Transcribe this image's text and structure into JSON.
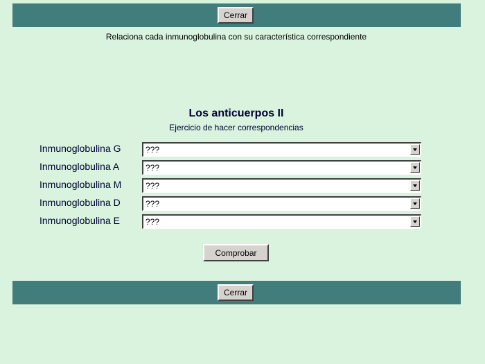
{
  "header": {
    "close_label": "Cerrar"
  },
  "instruction": "Relaciona cada inmunoglobulina con su característica correspondiente",
  "exercise": {
    "title": "Los anticuerpos II",
    "subtitle": "Ejercicio de hacer correspondencias",
    "rows": [
      {
        "label": "Inmunoglobulina G",
        "selected": "???"
      },
      {
        "label": "Inmunoglobulina A",
        "selected": "???"
      },
      {
        "label": "Inmunoglobulina M",
        "selected": "???"
      },
      {
        "label": "Inmunoglobulina D",
        "selected": "???"
      },
      {
        "label": "Inmunoglobulina E",
        "selected": "???"
      }
    ],
    "check_label": "Comprobar"
  },
  "footer": {
    "close_label": "Cerrar"
  },
  "colors": {
    "background": "#d9f3df",
    "bar": "#417d7d",
    "button_face": "#d6d3ce"
  }
}
